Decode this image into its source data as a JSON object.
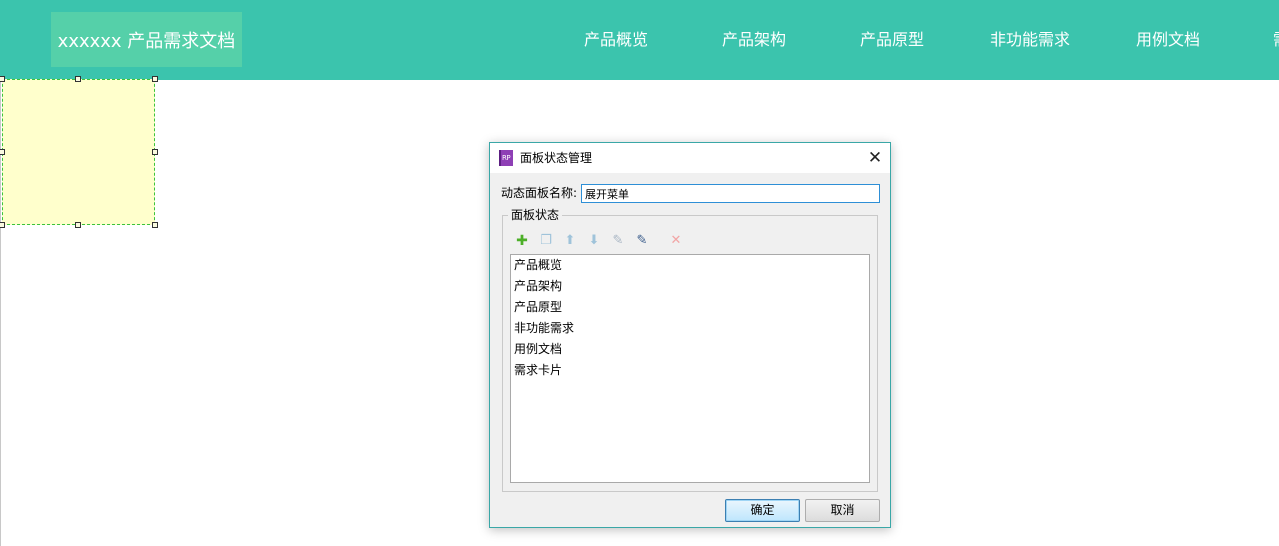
{
  "header": {
    "logo_text": "xxxxxx 产品需求文档",
    "nav": [
      {
        "label": "产品概览"
      },
      {
        "label": "产品架构"
      },
      {
        "label": "产品原型"
      },
      {
        "label": "非功能需求"
      },
      {
        "label": "用例文档"
      },
      {
        "label": "需"
      }
    ]
  },
  "dialog": {
    "title": "面板状态管理",
    "app_icon_text": "RP",
    "close_glyph": "✕",
    "name_label": "动态面板名称:",
    "name_value": "展开菜单",
    "group_label": "面板状态",
    "toolbar": [
      {
        "icon": "add-icon",
        "glyph": "✚",
        "color": "#4caf28",
        "enabled": true
      },
      {
        "icon": "duplicate-icon",
        "glyph": "❐",
        "color": "#9fc3da",
        "enabled": false
      },
      {
        "icon": "move-up-icon",
        "glyph": "⬆",
        "color": "#9fc3da",
        "enabled": false
      },
      {
        "icon": "move-down-icon",
        "glyph": "⬇",
        "color": "#9fc3da",
        "enabled": false
      },
      {
        "icon": "edit-state-icon",
        "glyph": "✎",
        "color": "#a9b6c4",
        "enabled": false
      },
      {
        "icon": "edit-all-states-icon",
        "glyph": "✎",
        "color": "#3b5d8c",
        "enabled": true
      },
      {
        "icon": "delete-icon",
        "glyph": "✕",
        "color": "#f2a5a5",
        "enabled": false
      }
    ],
    "states": [
      {
        "label": "产品概览"
      },
      {
        "label": "产品架构"
      },
      {
        "label": "产品原型"
      },
      {
        "label": "非功能需求"
      },
      {
        "label": "用例文档"
      },
      {
        "label": "需求卡片"
      }
    ],
    "ok_label": "确定",
    "cancel_label": "取消"
  },
  "colors": {
    "header_bg": "#3bc4ad",
    "logo_bg": "#55d0a9",
    "panel_fill": "#ffffcc",
    "panel_border": "#3cc43c"
  }
}
